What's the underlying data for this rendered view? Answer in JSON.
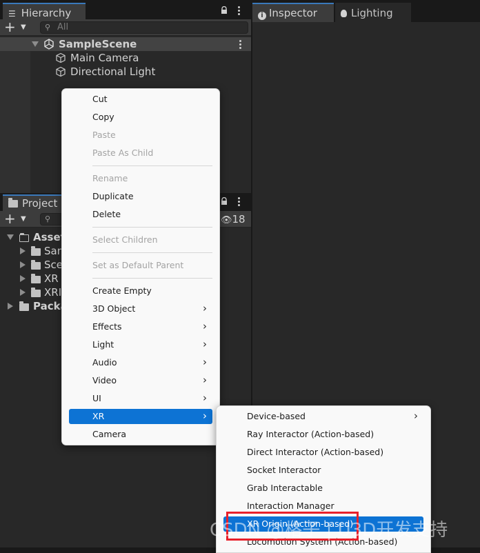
{
  "hierarchy": {
    "tab_label": "Hierarchy",
    "search_placeholder": "All",
    "scene_name": "SampleScene",
    "items": [
      "Main Camera",
      "Directional Light"
    ]
  },
  "inspector": {
    "tabs": [
      {
        "label": "Inspector",
        "icon": "info-icon"
      },
      {
        "label": "Lighting",
        "icon": "light-bulb-icon"
      }
    ]
  },
  "project": {
    "tab_label": "Project",
    "hidden_count": "18",
    "tree": [
      {
        "label": "Asset",
        "level": 0,
        "expanded": true
      },
      {
        "label": "San",
        "level": 1
      },
      {
        "label": "Sce",
        "level": 1
      },
      {
        "label": "XR",
        "level": 1
      },
      {
        "label": "XRI",
        "level": 1
      },
      {
        "label": "Packa",
        "level": 0,
        "expanded": false
      }
    ]
  },
  "context_menu": {
    "items": [
      {
        "label": "Cut"
      },
      {
        "label": "Copy"
      },
      {
        "label": "Paste",
        "disabled": true
      },
      {
        "label": "Paste As Child",
        "disabled": true
      },
      {
        "label": "Rename",
        "disabled": true
      },
      {
        "label": "Duplicate"
      },
      {
        "label": "Delete"
      },
      {
        "label": "Select Children",
        "disabled": true
      },
      {
        "label": "Set as Default Parent",
        "disabled": true
      },
      {
        "label": "Create Empty"
      },
      {
        "label": "3D Object",
        "submenu": true
      },
      {
        "label": "Effects",
        "submenu": true
      },
      {
        "label": "Light",
        "submenu": true
      },
      {
        "label": "Audio",
        "submenu": true
      },
      {
        "label": "Video",
        "submenu": true
      },
      {
        "label": "UI",
        "submenu": true
      },
      {
        "label": "XR",
        "submenu": true,
        "selected": true
      },
      {
        "label": "Camera"
      }
    ]
  },
  "xr_submenu": {
    "items": [
      {
        "label": "Device-based",
        "submenu": true
      },
      {
        "label": "Ray Interactor (Action-based)"
      },
      {
        "label": "Direct Interactor (Action-based)"
      },
      {
        "label": "Socket Interactor"
      },
      {
        "label": "Grab Interactable"
      },
      {
        "label": "Interaction Manager"
      },
      {
        "label": "XR Origin (Action-based)",
        "selected": true
      },
      {
        "label": "Locomotion System (Action-based)"
      }
    ]
  },
  "watermark": "CSDN @格子 | U3D开发支持",
  "colors": {
    "selection": "#0d73d4",
    "highlight_box": "#e8202a",
    "panel_bg": "#282828"
  }
}
